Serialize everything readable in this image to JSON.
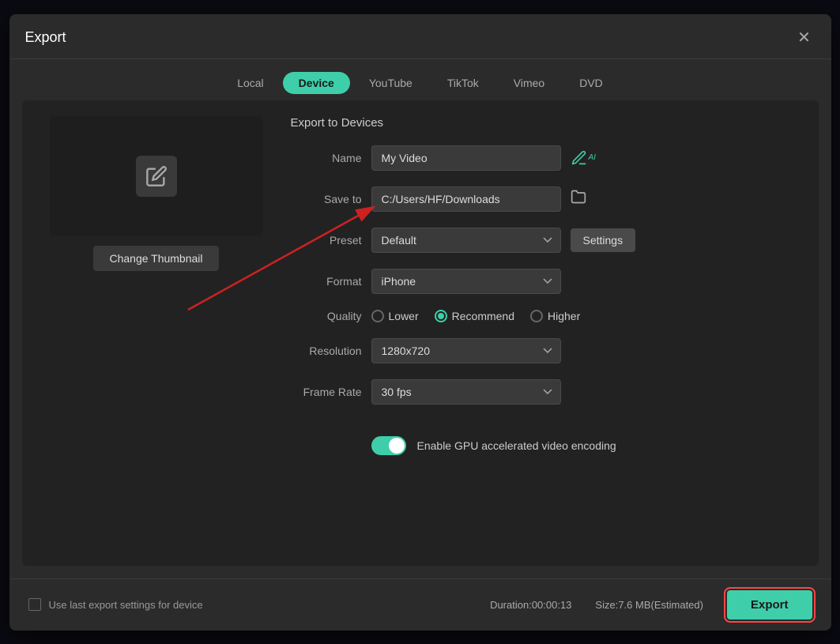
{
  "dialog": {
    "title": "Export",
    "close_label": "✕"
  },
  "tabs": {
    "items": [
      {
        "id": "local",
        "label": "Local",
        "active": false
      },
      {
        "id": "device",
        "label": "Device",
        "active": true
      },
      {
        "id": "youtube",
        "label": "YouTube",
        "active": false
      },
      {
        "id": "tiktok",
        "label": "TikTok",
        "active": false
      },
      {
        "id": "vimeo",
        "label": "Vimeo",
        "active": false
      },
      {
        "id": "dvd",
        "label": "DVD",
        "active": false
      }
    ]
  },
  "thumbnail": {
    "change_label": "Change Thumbnail"
  },
  "form": {
    "section_title": "Export to Devices",
    "name_label": "Name",
    "name_value": "My Video",
    "save_to_label": "Save to",
    "save_to_value": "C:/Users/HF/Downloads",
    "preset_label": "Preset",
    "preset_value": "Default",
    "settings_label": "Settings",
    "format_label": "Format",
    "format_value": "iPhone",
    "quality_label": "Quality",
    "quality_lower": "Lower",
    "quality_recommend": "Recommend",
    "quality_higher": "Higher",
    "resolution_label": "Resolution",
    "resolution_value": "1280x720",
    "frame_rate_label": "Frame Rate",
    "frame_rate_value": "30 fps",
    "gpu_label": "Enable GPU accelerated video encoding"
  },
  "footer": {
    "checkbox_label": "Use last export settings for device",
    "duration_label": "Duration:",
    "duration_value": "00:00:13",
    "size_label": "Size:",
    "size_value": "7.6 MB(Estimated)",
    "export_label": "Export"
  }
}
